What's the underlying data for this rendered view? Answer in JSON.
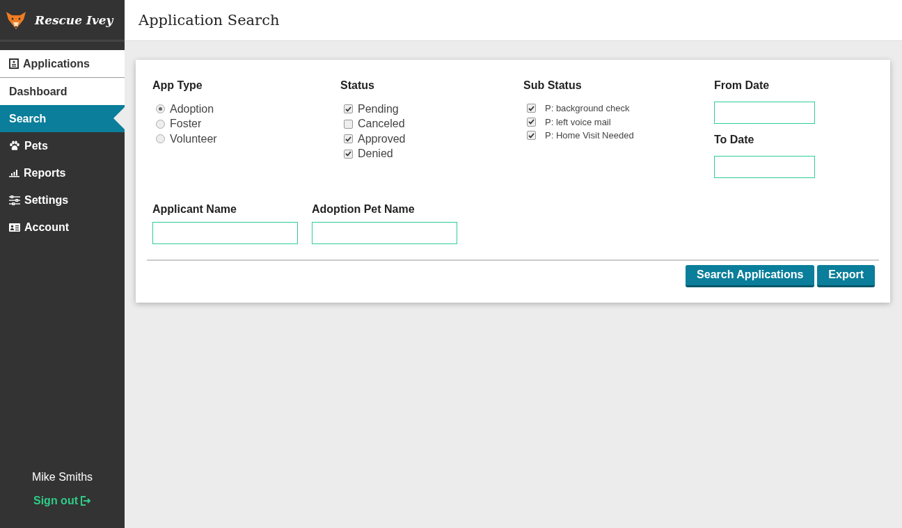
{
  "brand": {
    "name": "Rescue Ivey"
  },
  "sidebar": {
    "items": [
      {
        "label": "Applications",
        "kind": "section",
        "selected": false
      },
      {
        "label": "Dashboard",
        "kind": "subitem",
        "selected": false
      },
      {
        "label": "Search",
        "kind": "subitem",
        "selected": true
      },
      {
        "label": "Pets",
        "kind": "item",
        "selected": false
      },
      {
        "label": "Reports",
        "kind": "item",
        "selected": false
      },
      {
        "label": "Settings",
        "kind": "item",
        "selected": false
      },
      {
        "label": "Account",
        "kind": "item",
        "selected": false
      }
    ],
    "user": {
      "name": "Mike Smiths",
      "sign_out": "Sign out"
    }
  },
  "header": {
    "title": "Application Search"
  },
  "form": {
    "app_type": {
      "label": "App Type",
      "options": [
        {
          "label": "Adoption",
          "selected": true
        },
        {
          "label": "Foster",
          "selected": false
        },
        {
          "label": "Volunteer",
          "selected": false
        }
      ]
    },
    "status": {
      "label": "Status",
      "options": [
        {
          "label": "Pending",
          "checked": true
        },
        {
          "label": "Canceled",
          "checked": false
        },
        {
          "label": "Approved",
          "checked": true
        },
        {
          "label": "Denied",
          "checked": true
        }
      ]
    },
    "sub_status": {
      "label": "Sub Status",
      "options": [
        {
          "label": "P: background check",
          "checked": true
        },
        {
          "label": "P: left voice mail",
          "checked": true
        },
        {
          "label": "P: Home Visit Needed",
          "checked": true
        }
      ]
    },
    "from_date": {
      "label": "From Date"
    },
    "to_date": {
      "label": "To Date"
    },
    "applicant_name": {
      "label": "Applicant Name"
    },
    "adoption_pet_name": {
      "label": "Adoption Pet Name"
    },
    "buttons": [
      "Search Applications",
      "Export"
    ]
  }
}
